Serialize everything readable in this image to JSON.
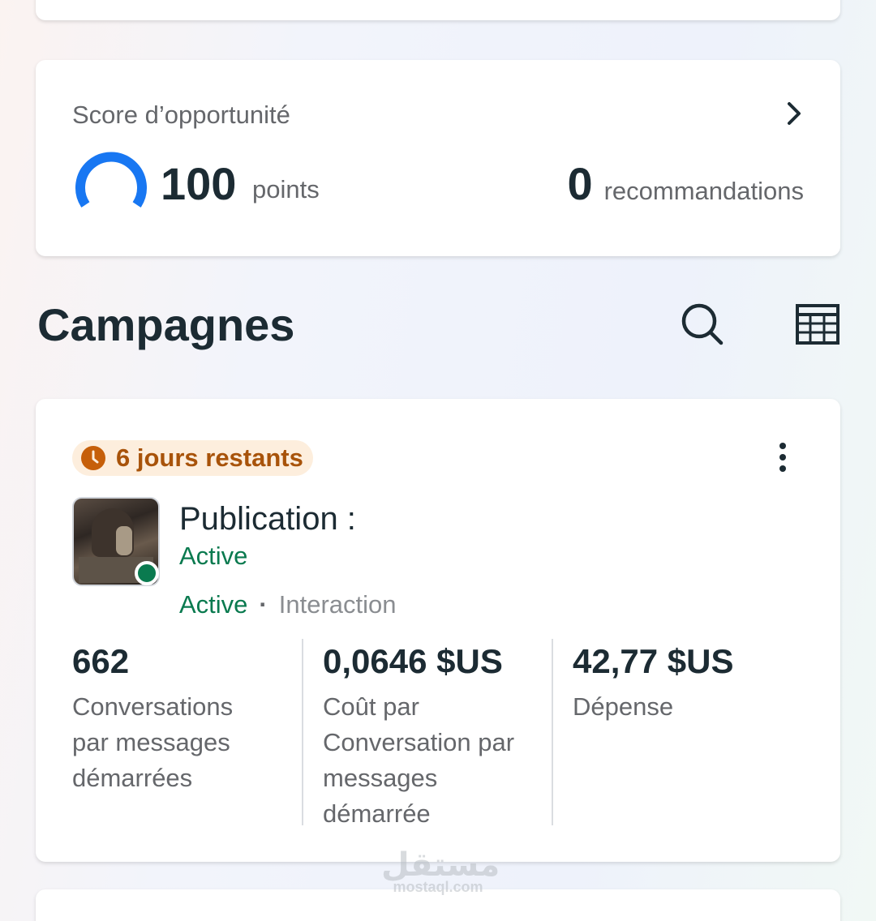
{
  "score": {
    "label": "Score d’opportunité",
    "points_value": "100",
    "points_unit": "points",
    "recommendations_value": "0",
    "recommendations_unit": "recommandations",
    "gauge_fill": 1.0,
    "gauge_color": "#1877f2"
  },
  "campaigns": {
    "title": "Campagnes"
  },
  "campaign_card": {
    "badge_text": "6 jours restants",
    "badge_color": "#a8530a",
    "title": "Publication : ",
    "status": "Active",
    "status_secondary": "Active",
    "separator": "·",
    "goal": "Interaction",
    "status_color": "#0a7a4f",
    "metrics": [
      {
        "value": "662",
        "label": "Conversations par messages démarrées"
      },
      {
        "value": "0,0646 $US",
        "label": "Coût par Conversation par messages démarrée"
      },
      {
        "value": "42,77 $US",
        "label": "Dépense"
      }
    ]
  },
  "watermark": {
    "logo": "مستقل",
    "url": "mostaql.com"
  }
}
